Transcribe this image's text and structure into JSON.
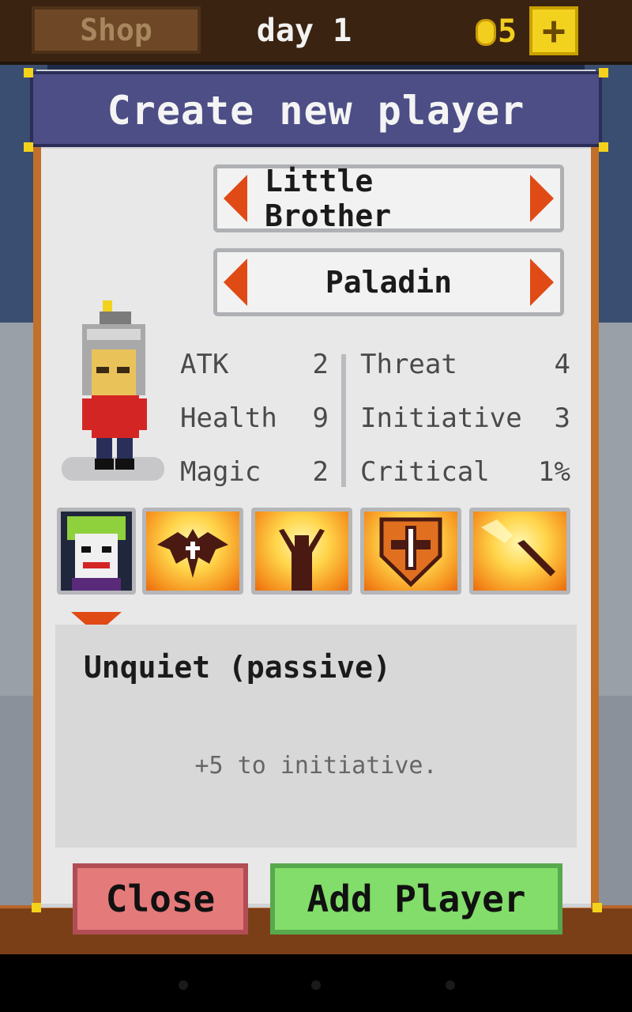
{
  "topbar": {
    "shop_label": "Shop",
    "day_label": "day 1",
    "coins": "5",
    "plus_symbol": "+"
  },
  "dialog": {
    "title": "Create new player",
    "player_name": "Little Brother",
    "player_class": "Paladin",
    "stats_left": [
      {
        "label": "ATK",
        "value": "2"
      },
      {
        "label": "Health",
        "value": "9"
      },
      {
        "label": "Magic",
        "value": "2"
      }
    ],
    "stats_right": [
      {
        "label": "Threat",
        "value": "4"
      },
      {
        "label": "Initiative",
        "value": "3"
      },
      {
        "label": "Critical",
        "value": "1%"
      }
    ],
    "skills": [
      {
        "icon": "joker-portrait-icon"
      },
      {
        "icon": "bat-icon"
      },
      {
        "icon": "figure-arms-raised-icon"
      },
      {
        "icon": "cross-shield-icon"
      },
      {
        "icon": "sword-icon"
      }
    ],
    "selected_skill": {
      "title": "Unquiet (passive)",
      "description": "+5 to initiative."
    },
    "close_label": "Close",
    "add_label": "Add Player"
  },
  "colors": {
    "header": "#4d4e86",
    "arrow": "#e04a14",
    "close_button": "#e57a7a",
    "add_button": "#82dd6a",
    "coin": "#f2cf1e"
  }
}
